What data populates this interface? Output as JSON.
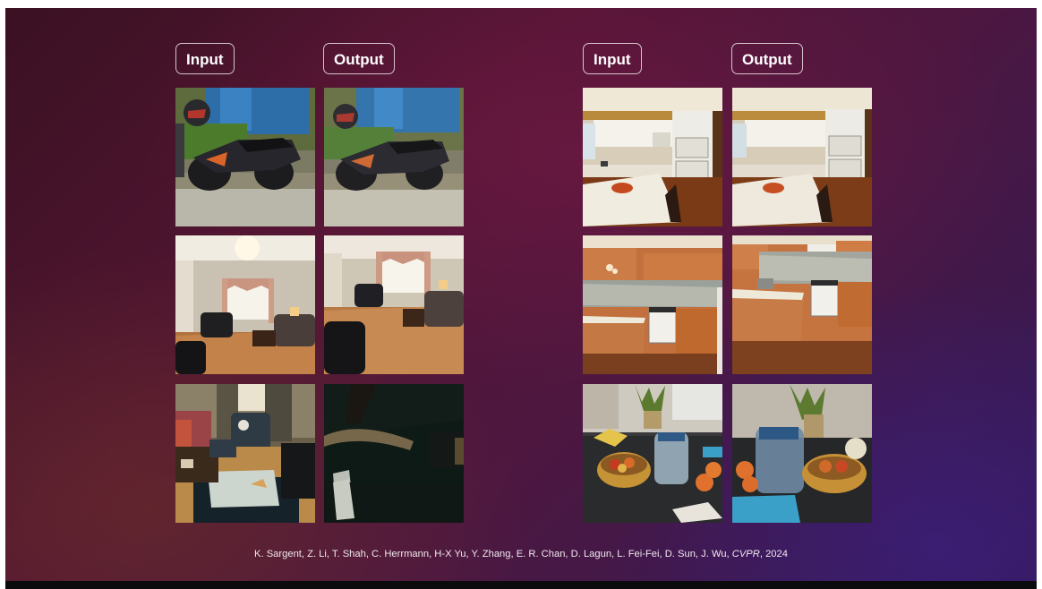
{
  "left_group": {
    "input_label": "Input",
    "output_label": "Output"
  },
  "right_group": {
    "input_label": "Input",
    "output_label": "Output"
  },
  "citation": {
    "authors": "K. Sargent, Z. Li, T. Shah, C. Herrmann, H-X Yu, Y. Zhang, E. R. Chan, D. Lagun, L. Fei-Fei, D. Sun, J. Wu, ",
    "venue": "CVPR",
    "year": ", 2024"
  },
  "colors": {
    "slide_bg_dark": "#3b1122",
    "slide_bg_mid": "#521533",
    "slide_bg_purple": "#311a56",
    "label_border": "#ffffff",
    "text": "#ffffff"
  }
}
